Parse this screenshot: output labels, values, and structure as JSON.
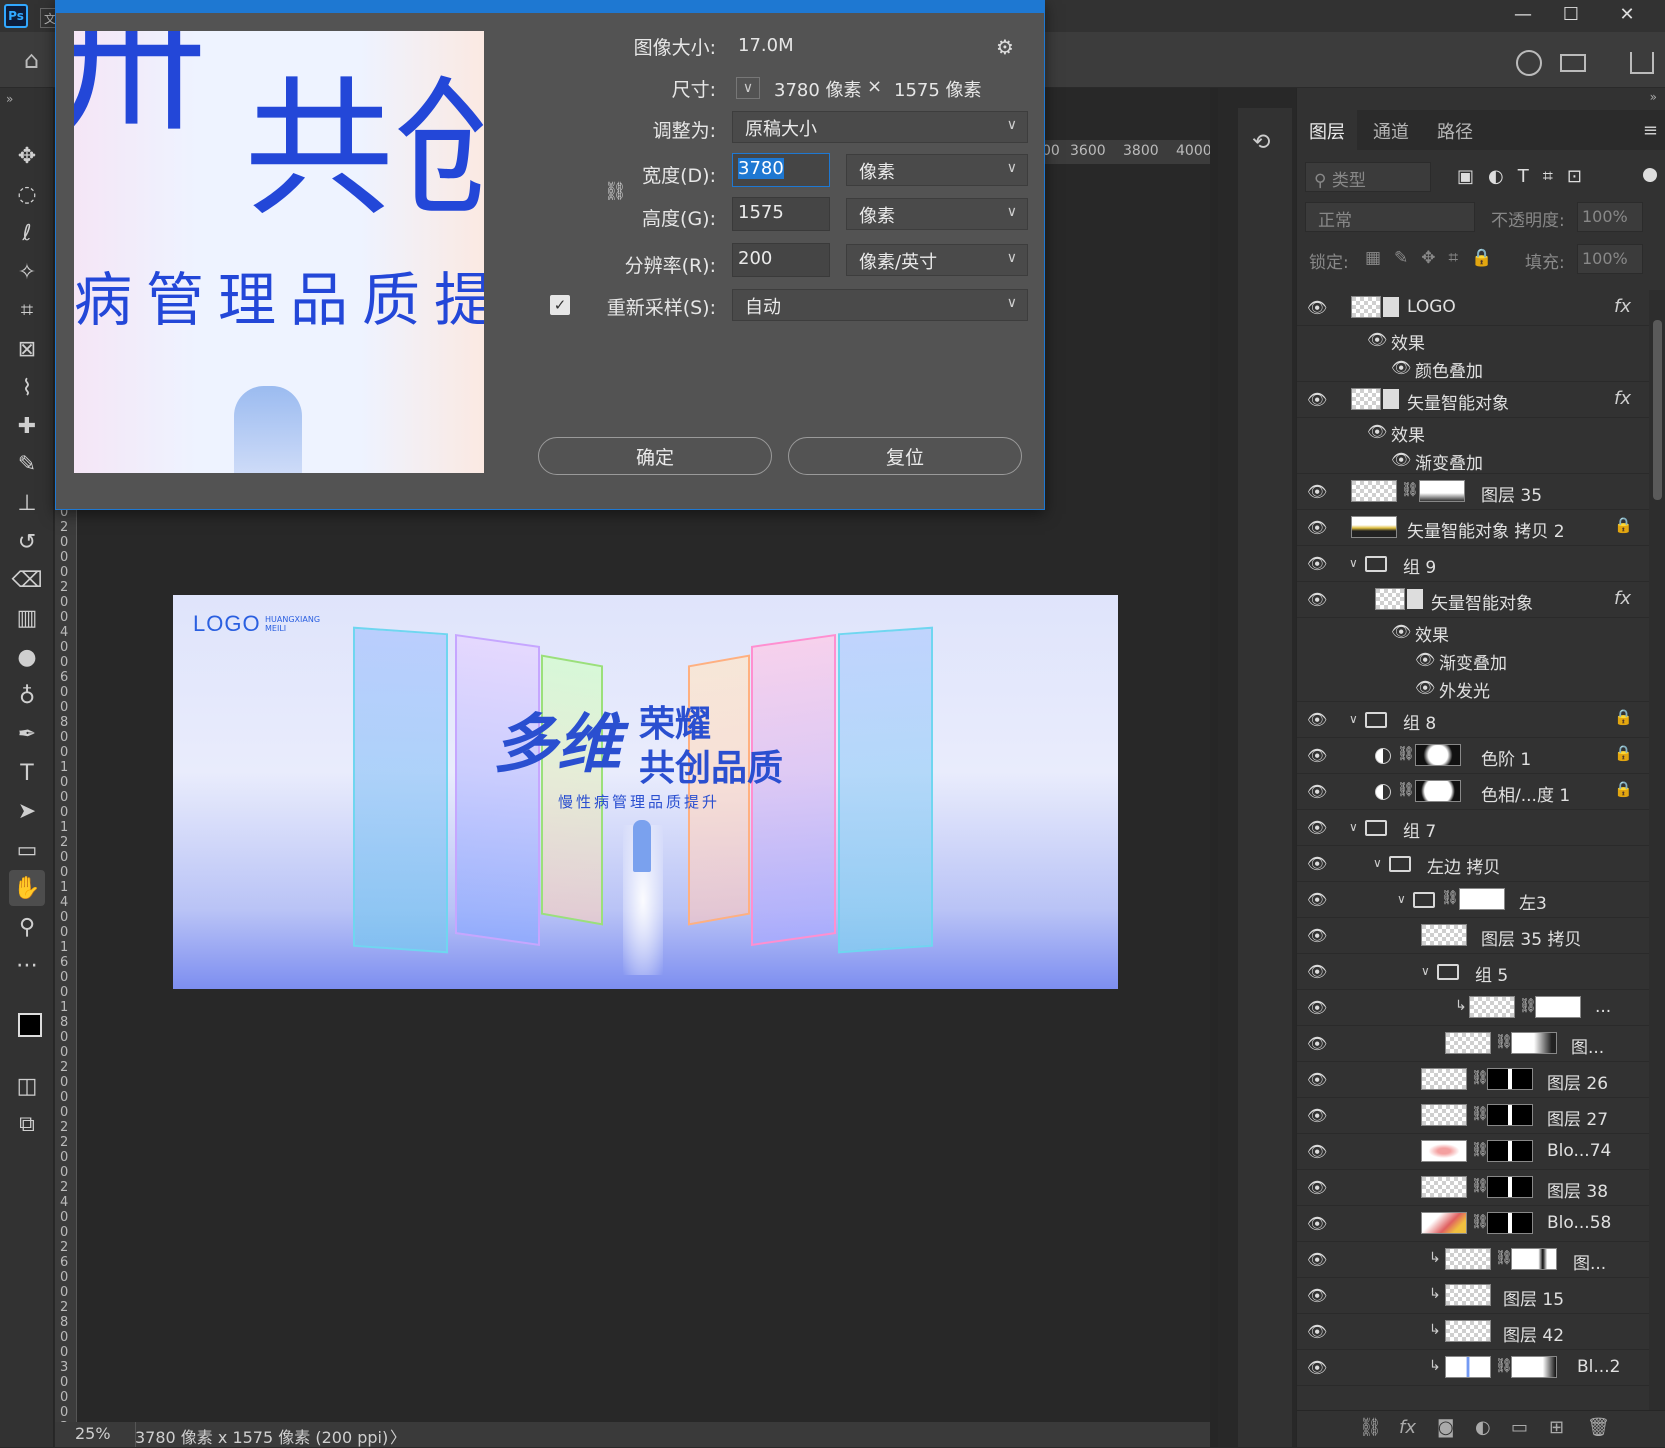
{
  "app": {
    "logo_text": "Ps",
    "menu_stub": "文",
    "window_controls": [
      "—",
      "☐",
      "✕"
    ]
  },
  "dialog": {
    "image_size_label": "图像大小:",
    "image_size_value": "17.0M",
    "dimensions_label": "尺寸:",
    "dimensions_width": "3780 像素",
    "dimensions_sep": "×",
    "dimensions_height": "1575 像素",
    "fit_to_label": "调整为:",
    "fit_to_value": "原稿大小",
    "width_label": "宽度(D):",
    "width_value": "3780",
    "width_unit": "像素",
    "height_label": "高度(G):",
    "height_value": "1575",
    "height_unit": "像素",
    "resolution_label": "分辨率(R):",
    "resolution_value": "200",
    "resolution_unit": "像素/英寸",
    "resample_label": "重新采样(S):",
    "resample_checked": true,
    "resample_value": "自动",
    "ok_label": "确定",
    "reset_label": "复位"
  },
  "preview": {
    "big_chars_top": "共创",
    "big_chars_left": "卅",
    "subtitle_fragment": "病管理品质提"
  },
  "artwork": {
    "logo": "LOGO",
    "logo_sub1": "HUANGXIANG",
    "logo_sub2": "MEILI",
    "title_main": "多维",
    "title_line1": "荣耀",
    "title_line2": "共创品质",
    "subtitle": "慢性病管理品质提升"
  },
  "rulers": {
    "top_ticks": [
      "00",
      "3600",
      "3800",
      "4000"
    ],
    "left_ticks": [
      "0",
      "0",
      "2",
      "0",
      "0",
      "0",
      "2",
      "0",
      "0",
      "4",
      "0",
      "0",
      "6",
      "0",
      "0",
      "8",
      "0",
      "0",
      "1",
      "0",
      "0",
      "0",
      "1",
      "2",
      "0",
      "0",
      "1",
      "4",
      "0",
      "0",
      "1",
      "6",
      "0",
      "0",
      "1",
      "8",
      "0",
      "0",
      "2",
      "0",
      "0",
      "0",
      "2",
      "2",
      "0",
      "0",
      "2",
      "4",
      "0",
      "0",
      "2",
      "6",
      "0",
      "0",
      "2",
      "8",
      "0",
      "0",
      "3",
      "0",
      "0",
      "0",
      "3"
    ]
  },
  "status": {
    "zoom": "25%",
    "doc_info": "3780 像素 x 1575 像素 (200 ppi)",
    "arrow": "〉"
  },
  "layers_panel": {
    "tabs": [
      "图层",
      "通道",
      "路径"
    ],
    "active_tab": 0,
    "filter_placeholder": "类型",
    "blend_mode": "正常",
    "opacity_label": "不透明度:",
    "opacity_value": "100%",
    "lock_label": "锁定:",
    "fill_label": "填充:",
    "fill_value": "100%",
    "layers": [
      {
        "name": "LOGO",
        "fx": true
      },
      {
        "name": "效果",
        "sub": 1
      },
      {
        "name": "颜色叠加",
        "sub": 2
      },
      {
        "name": "矢量智能对象",
        "fx": true
      },
      {
        "name": "效果",
        "sub": 1
      },
      {
        "name": "渐变叠加",
        "sub": 2
      },
      {
        "name": "图层 35"
      },
      {
        "name": "矢量智能对象 拷贝 2",
        "lock": true
      },
      {
        "name": "组 9",
        "group": true
      },
      {
        "name": "矢量智能对象",
        "fx": true
      },
      {
        "name": "效果",
        "sub": 1
      },
      {
        "name": "渐变叠加",
        "sub": 2
      },
      {
        "name": "外发光",
        "sub": 2
      },
      {
        "name": "组 8",
        "group": true,
        "lock": true
      },
      {
        "name": "色阶 1",
        "lock": true
      },
      {
        "name": "色相/...度 1",
        "lock": true
      },
      {
        "name": "组 7",
        "group": true
      },
      {
        "name": "左边 拷贝",
        "group": true
      },
      {
        "name": "左3",
        "group": true
      },
      {
        "name": "图层 35 拷贝"
      },
      {
        "name": "组 5",
        "group": true
      },
      {
        "name": "..."
      },
      {
        "name": "图..."
      },
      {
        "name": "图层 26"
      },
      {
        "name": "图层 27"
      },
      {
        "name": "Blo...74"
      },
      {
        "name": "图层 38"
      },
      {
        "name": "Blo...58"
      },
      {
        "name": "图..."
      },
      {
        "name": "图层 15"
      },
      {
        "name": "图层 42"
      },
      {
        "name": "Bl...2"
      }
    ],
    "bottom_icons": [
      "link-icon",
      "fx-icon",
      "mask-icon",
      "adjustment-icon",
      "folder-icon",
      "new-layer-icon",
      "trash-icon"
    ]
  },
  "colors": {
    "accent": "#1e78d2",
    "panel_bg": "#323232",
    "canvas_bg": "#282828",
    "title_blue": "#2a4fd0"
  }
}
